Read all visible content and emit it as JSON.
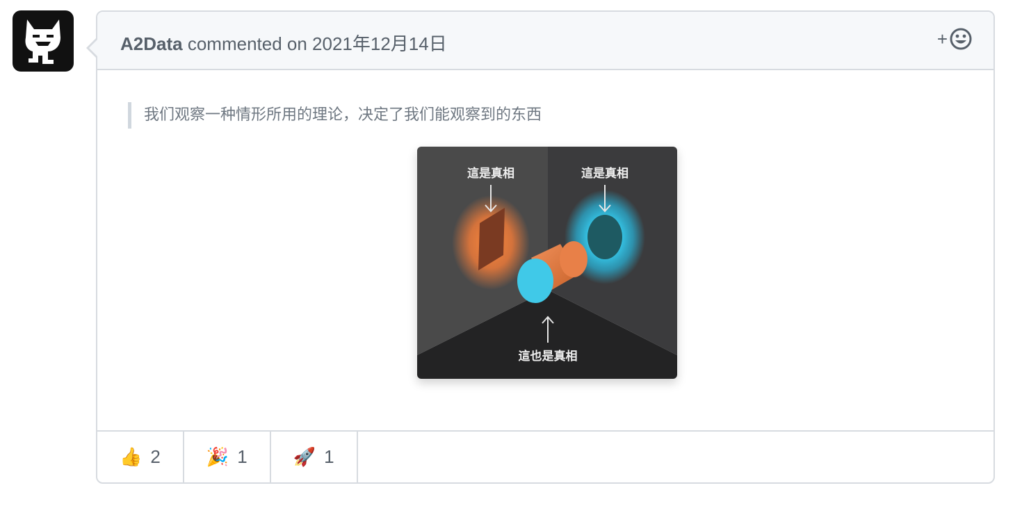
{
  "comment": {
    "author": "A2Data",
    "action_text": "commented on 2021年12月14日",
    "add_reaction_label": "+",
    "quote": "我们观察一种情形所用的理论，决定了我们能观察到的东西",
    "figure": {
      "label_top_left": "這是真相",
      "label_top_right": "這是真相",
      "label_bottom": "這也是真相"
    }
  },
  "reactions": [
    {
      "emoji": "👍",
      "count": "2",
      "icon": "thumbs-up-icon"
    },
    {
      "emoji": "🎉",
      "count": "1",
      "icon": "party-popper-icon"
    },
    {
      "emoji": "🚀",
      "count": "1",
      "icon": "rocket-icon"
    }
  ],
  "colors": {
    "border": "#d7dbe0",
    "header_bg": "#f6f8fa",
    "text_muted": "#57606a",
    "orange": "#e57f3f",
    "cyan": "#3cc8e6"
  }
}
